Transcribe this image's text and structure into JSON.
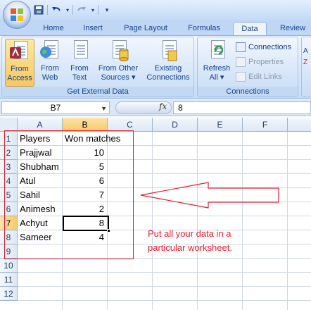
{
  "quick_access": {
    "save_icon": "save-icon",
    "undo_icon": "undo-icon",
    "redo_icon": "redo-icon"
  },
  "tabs": [
    {
      "label": "Home"
    },
    {
      "label": "Insert"
    },
    {
      "label": "Page Layout"
    },
    {
      "label": "Formulas"
    },
    {
      "label": "Data",
      "active": true
    },
    {
      "label": "Review"
    }
  ],
  "ribbon": {
    "get_external_data": {
      "label": "Get External Data",
      "buttons": [
        {
          "line1": "From",
          "line2": "Access",
          "pressed": true
        },
        {
          "line1": "From",
          "line2": "Web"
        },
        {
          "line1": "From",
          "line2": "Text"
        },
        {
          "line1": "From Other",
          "line2": "Sources ▾"
        },
        {
          "line1": "Existing",
          "line2": "Connections"
        }
      ]
    },
    "connections": {
      "label": "Connections",
      "refresh_line1": "Refresh",
      "refresh_line2": "All ▾",
      "connections": "Connections",
      "properties": "Properties",
      "edit_links": "Edit Links"
    }
  },
  "formula_bar": {
    "name_box": "B7",
    "fx": "fx",
    "value": "8"
  },
  "sheet": {
    "columns": [
      "A",
      "B",
      "C",
      "D",
      "E",
      "F"
    ],
    "rows": [
      "1",
      "2",
      "3",
      "4",
      "5",
      "6",
      "7",
      "8",
      "9",
      "10",
      "11",
      "12"
    ],
    "selected_column": "B",
    "selected_row": "7",
    "headers": {
      "a": "Players",
      "b": "Won matches"
    },
    "data": [
      {
        "player": "Prajjwal",
        "won": "10"
      },
      {
        "player": "Shubham",
        "won": "5"
      },
      {
        "player": "Atul",
        "won": "6"
      },
      {
        "player": "Sahil",
        "won": "7"
      },
      {
        "player": "Animesh",
        "won": "2"
      },
      {
        "player": "Achyut",
        "won": "8"
      },
      {
        "player": "Sameer",
        "won": "4"
      }
    ]
  },
  "annotation": {
    "text": "Put all your data in a particular worksheet.",
    "color": "#e8202a"
  },
  "colors": {
    "ribbon": "#d7e6f9",
    "selected_header": "#f8ca6b",
    "annotation_border": "#d9232d"
  }
}
